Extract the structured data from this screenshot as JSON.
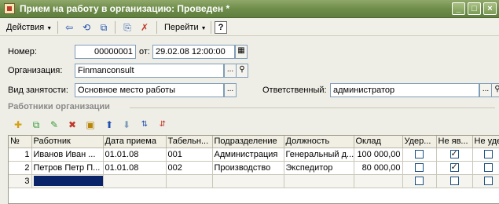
{
  "window": {
    "title": "Прием на работу в организацию: Проведен *",
    "controls": [
      "_",
      "□",
      "×"
    ]
  },
  "toolbar": {
    "actions_label": "Действия",
    "goto_label": "Перейти",
    "help_label": "?"
  },
  "form": {
    "number_label": "Номер:",
    "number_value": "00000001",
    "date_label": "от:",
    "date_value": "29.02.08 12:00:00",
    "org_label": "Организация:",
    "org_value": "Finmanconsult",
    "employment_label": "Вид занятости:",
    "employment_value": "Основное место работы",
    "responsible_label": "Ответственный:",
    "responsible_value": "администратор"
  },
  "employees": {
    "section_title": "Работники организации",
    "columns": [
      "№",
      "Работник",
      "Дата приема",
      "Табельн...",
      "Подразделение",
      "Должность",
      "Оклад",
      "Удер...",
      "Не яв...",
      "Не уде..."
    ],
    "rows": [
      {
        "n": "1",
        "employee": "Иванов Иван ...",
        "hire_date": "01.01.08",
        "tab_no": "001",
        "department": "Администрация",
        "position": "Генеральный д...",
        "salary": "100 000,00",
        "c1": false,
        "c2": true,
        "c3": false
      },
      {
        "n": "2",
        "employee": "Петров Петр П...",
        "hire_date": "01.01.08",
        "tab_no": "002",
        "department": "Производство",
        "position": "Экспедитор",
        "salary": "80 000,00",
        "c1": false,
        "c2": true,
        "c3": false
      },
      {
        "n": "3",
        "employee": "",
        "hire_date": "",
        "tab_no": "",
        "department": "",
        "position": "",
        "salary": "",
        "c1": false,
        "c2": false,
        "c3": false
      }
    ]
  }
}
